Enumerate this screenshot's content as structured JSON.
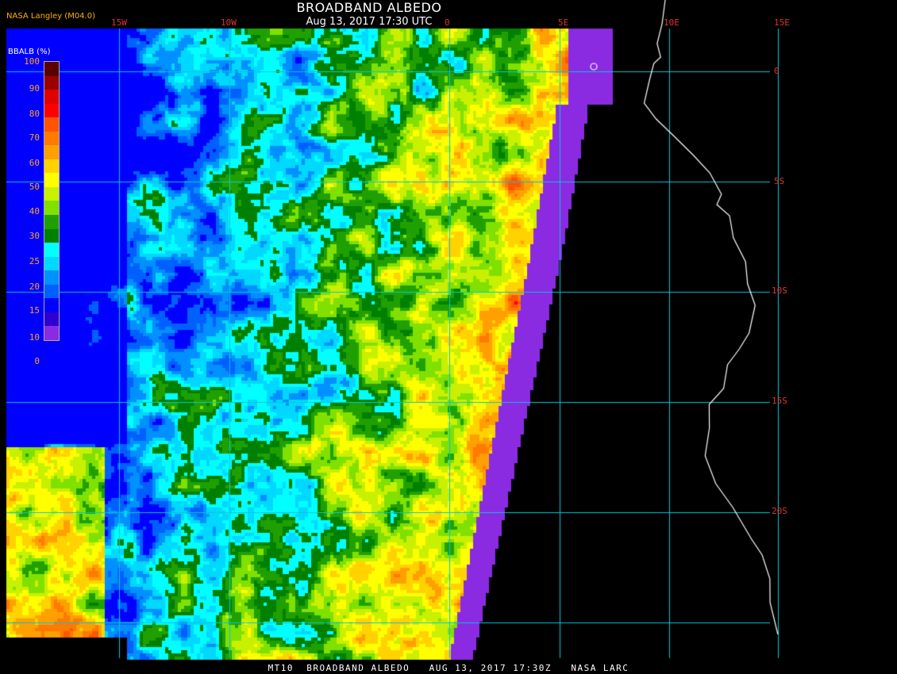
{
  "header": {
    "title": "BROADBAND ALBEDO",
    "subtitle": "Aug 13, 2017 17:30 UTC",
    "brand": "NASA Langley (M04.0)"
  },
  "legend": {
    "title": "BBALB (%)",
    "ticks": [
      "100",
      "90",
      "80",
      "70",
      "60",
      "50",
      "40",
      "30",
      "25",
      "20",
      "15",
      "10",
      "0"
    ],
    "bins": [
      {
        "range": "90-100",
        "color": "#5a0000"
      },
      {
        "range": "85-90",
        "color": "#9a0000"
      },
      {
        "range": "80-85",
        "color": "#e00000"
      },
      {
        "range": "70-80",
        "color": "#ff0000"
      },
      {
        "range": "65-70",
        "color": "#ff5500"
      },
      {
        "range": "60-65",
        "color": "#ff7a00"
      },
      {
        "range": "55-60",
        "color": "#ffa000"
      },
      {
        "range": "50-55",
        "color": "#ffd200"
      },
      {
        "range": "45-50",
        "color": "#ffff00"
      },
      {
        "range": "40-45",
        "color": "#c8f000"
      },
      {
        "range": "35-40",
        "color": "#80e000"
      },
      {
        "range": "30-35",
        "color": "#20a000"
      },
      {
        "range": "25-30",
        "color": "#008000"
      },
      {
        "range": "22-25",
        "color": "#00ffff"
      },
      {
        "range": "20-22",
        "color": "#00d8ff"
      },
      {
        "range": "17-20",
        "color": "#0090ff"
      },
      {
        "range": "15-17",
        "color": "#0060ff"
      },
      {
        "range": "10-15",
        "color": "#0000ff"
      },
      {
        "range": "5-10",
        "color": "#3000d0"
      },
      {
        "range": "0-5",
        "color": "#8a2be2"
      }
    ]
  },
  "grid": {
    "lon_labels": [
      "15W",
      "10W",
      "0",
      "5E",
      "10E",
      "15E"
    ],
    "lat_labels": [
      "0",
      "5S",
      "10S",
      "15S",
      "20S"
    ],
    "line_color": "#00c8d8"
  },
  "footer": {
    "text": "MT10  BROADBAND ALBEDO   AUG 13, 2017 17:30Z   NASA LARC"
  },
  "colors": {
    "no_data": "#8a2be2",
    "background": "#000000",
    "coastline": "#ffffff"
  }
}
